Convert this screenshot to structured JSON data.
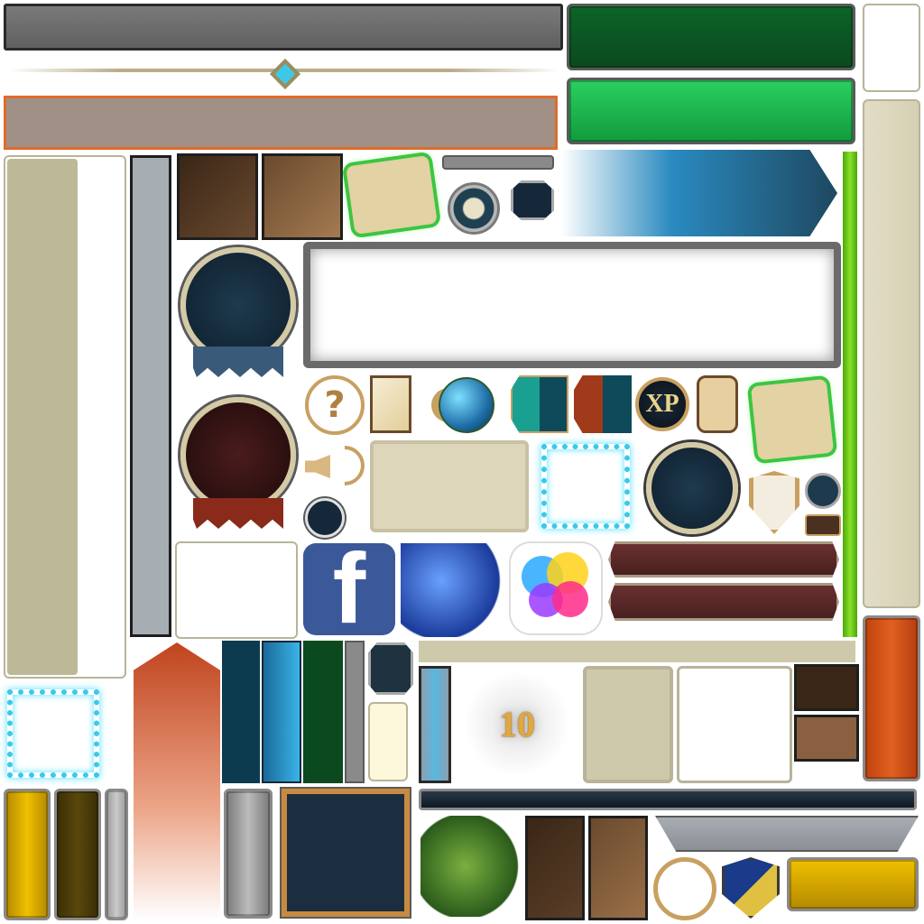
{
  "sheet": {
    "counter_badge": "10",
    "xp_badge": "XP",
    "facebook_letter": "f"
  },
  "colors": {
    "panel_gray": "#6f6f6f",
    "green_dark": "#0d5a23",
    "green_bright": "#19b24a",
    "parchment": "#d9d4bb",
    "orange": "#d9541a",
    "gold": "#d9a800",
    "glow_cyan": "#3ec8e8",
    "navy": "#14283a",
    "brown_dark": "#4a3020",
    "brown_light": "#8a6040",
    "maroon": "#5a2a2a",
    "facebook_blue": "#3b5998",
    "lime": "#7acc1a"
  },
  "icons": [
    "treasure-map-icon",
    "scroll-map-icon",
    "question-icon",
    "mail-icon",
    "globe-icon",
    "xp-icon",
    "puzzle-icon",
    "sound-icon",
    "shield-icon",
    "facebook-icon",
    "blue-dragon-icon",
    "game-center-icon",
    "green-dragon-icon",
    "world-rotate-icon",
    "knight-crest-icon"
  ]
}
